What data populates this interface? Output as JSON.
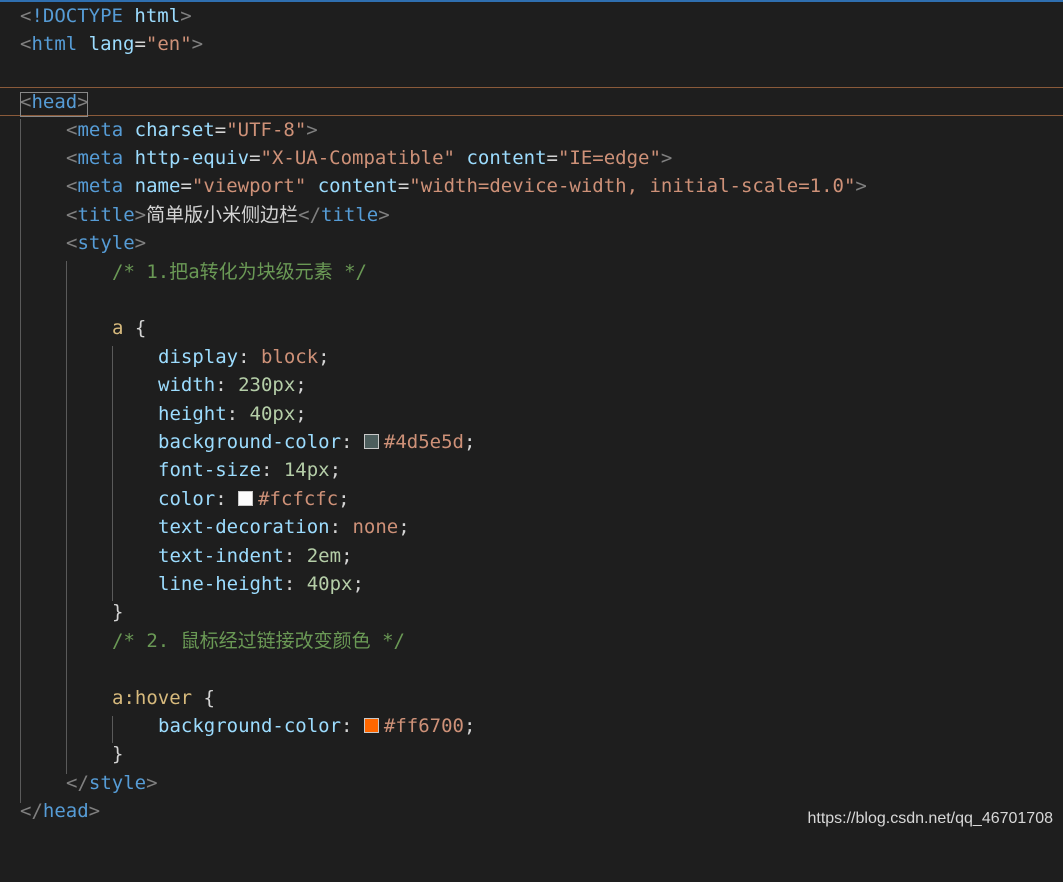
{
  "colors": {
    "editor_background": "#1e1e1e",
    "comment": "#6a9955",
    "tag": "#569cd6",
    "attribute": "#9cdcfe",
    "string": "#ce9178",
    "number": "#b5cea8",
    "selector": "#d7ba7d",
    "swatch_4d5e5d": "#4d5e5d",
    "swatch_fcfcfc": "#fcfcfc",
    "swatch_ff6700": "#ff6700"
  },
  "code": {
    "l1": {
      "doctype": "!DOCTYPE",
      "html": "html"
    },
    "l2": {
      "tag": "html",
      "attr": "lang",
      "value": "\"en\""
    },
    "l4": {
      "tag": "head"
    },
    "l5": {
      "tag": "meta",
      "attr": "charset",
      "value": "\"UTF-8\""
    },
    "l6": {
      "tag": "meta",
      "attr1": "http-equiv",
      "value1": "\"X-UA-Compatible\"",
      "attr2": "content",
      "value2": "\"IE=edge\""
    },
    "l7": {
      "tag": "meta",
      "attr1": "name",
      "value1": "\"viewport\"",
      "attr2": "content",
      "value2": "\"width=device-width, initial-scale=1.0\""
    },
    "l8": {
      "tag": "title",
      "text": "简单版小米侧边栏"
    },
    "l9": {
      "tag": "style"
    },
    "l10": {
      "comment": "/* 1.把a转化为块级元素 */"
    },
    "l12": {
      "selector": "a",
      "brace": "{"
    },
    "l13": {
      "prop": "display",
      "value": "block"
    },
    "l14": {
      "prop": "width",
      "value": "230px"
    },
    "l15": {
      "prop": "height",
      "value": "40px"
    },
    "l16": {
      "prop": "background-color",
      "value": "#4d5e5d"
    },
    "l17": {
      "prop": "font-size",
      "value": "14px"
    },
    "l18": {
      "prop": "color",
      "value": "#fcfcfc"
    },
    "l19": {
      "prop": "text-decoration",
      "value": "none"
    },
    "l20": {
      "prop": "text-indent",
      "value": "2em"
    },
    "l21": {
      "prop": "line-height",
      "value": "40px"
    },
    "l22": {
      "brace": "}"
    },
    "l23": {
      "comment": "/* 2. 鼠标经过链接改变颜色 */"
    },
    "l25": {
      "selector": "a:hover",
      "brace": "{"
    },
    "l26": {
      "prop": "background-color",
      "value": "#ff6700"
    },
    "l27": {
      "brace": "}"
    },
    "l28": {
      "tag": "style"
    },
    "l29": {
      "tag": "head"
    }
  },
  "watermark": "https://blog.csdn.net/qq_46701708"
}
